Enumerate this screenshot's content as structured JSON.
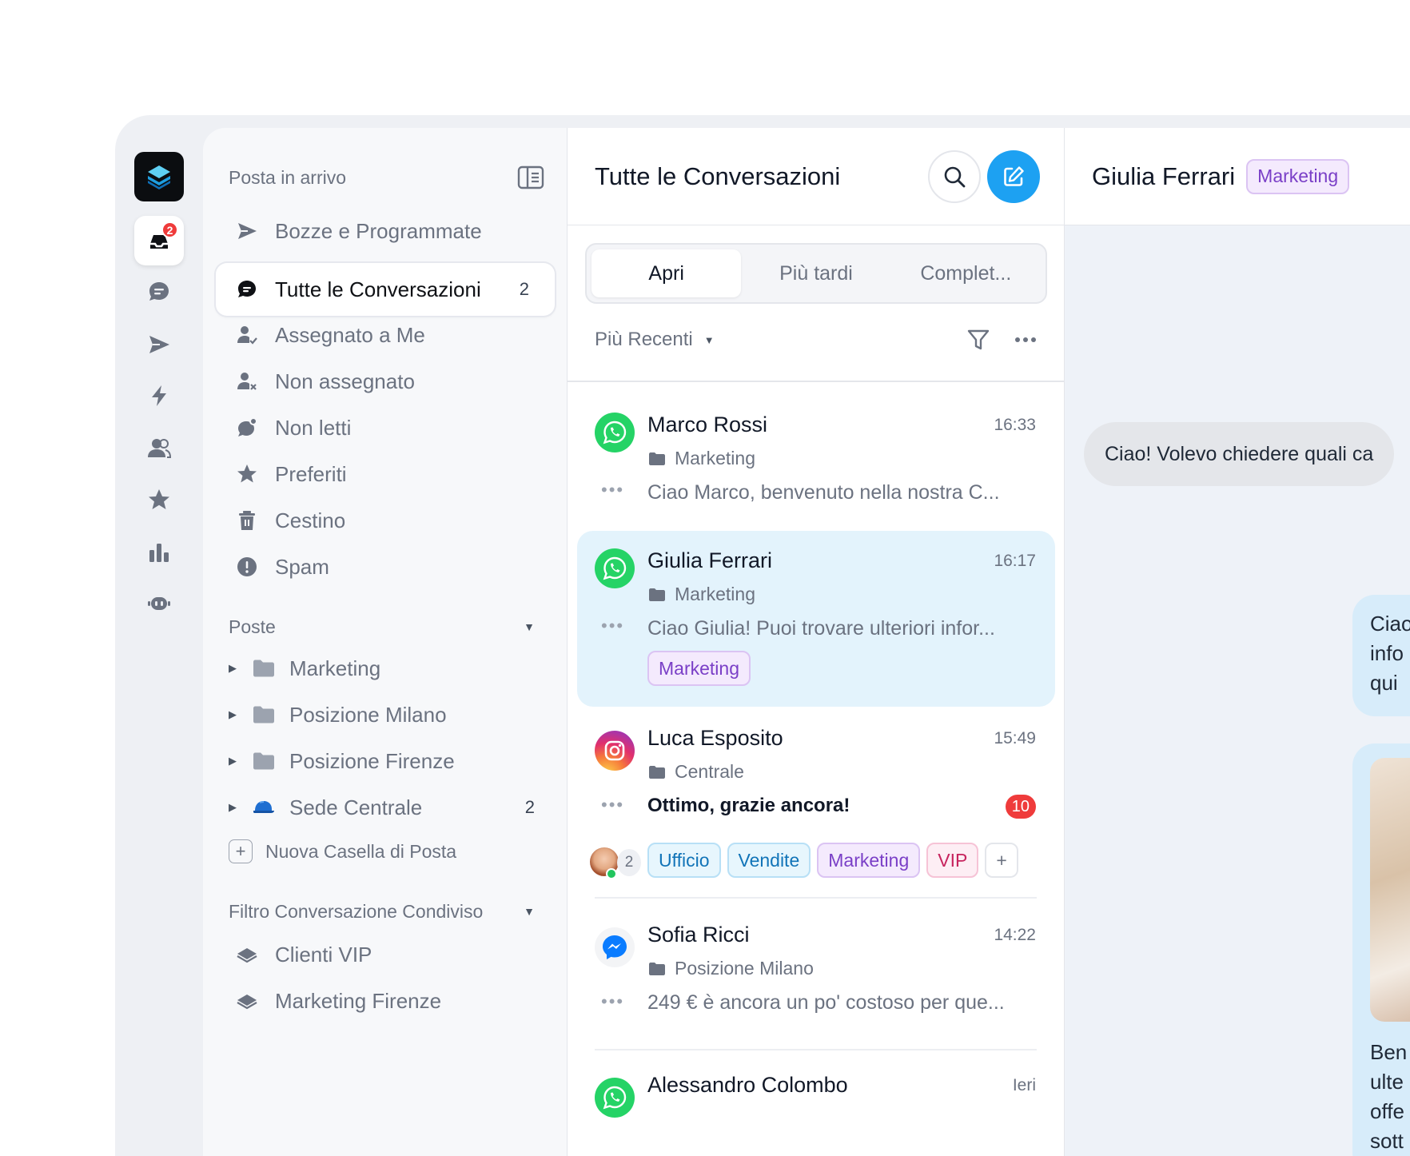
{
  "rail": {
    "inbox_badge": "2"
  },
  "nav": {
    "title": "Posta in arrivo",
    "items": [
      {
        "label": "Bozze e Programmate",
        "count": ""
      },
      {
        "label": "Tutte le Conversazioni",
        "count": "2"
      },
      {
        "label": "Assegnato a Me",
        "count": ""
      },
      {
        "label": "Non assegnato",
        "count": ""
      },
      {
        "label": "Non letti",
        "count": ""
      },
      {
        "label": "Preferiti",
        "count": ""
      },
      {
        "label": "Cestino",
        "count": ""
      },
      {
        "label": "Spam",
        "count": ""
      }
    ],
    "mail_section": "Poste",
    "mailboxes": [
      {
        "label": "Marketing",
        "count": ""
      },
      {
        "label": "Posizione Milano",
        "count": ""
      },
      {
        "label": "Posizione Firenze",
        "count": ""
      },
      {
        "label": "Sede Centrale",
        "count": "2"
      }
    ],
    "new_mailbox": "Nuova Casella di Posta",
    "shared_section": "Filtro Conversazione Condiviso",
    "shared_filters": [
      {
        "label": "Clienti VIP"
      },
      {
        "label": "Marketing Firenze"
      }
    ]
  },
  "list": {
    "title": "Tutte le Conversazioni",
    "tabs": [
      "Apri",
      "Più tardi",
      "Complet..."
    ],
    "sort_label": "Più Recenti",
    "conversations": [
      {
        "name": "Marco Rossi",
        "time": "16:33",
        "folder": "Marketing",
        "preview": "Ciao Marco, benvenuto nella nostra C...",
        "channel": "whatsapp"
      },
      {
        "name": "Giulia Ferrari",
        "time": "16:17",
        "folder": "Marketing",
        "preview": "Ciao Giulia! Puoi trovare ulteriori infor...",
        "channel": "whatsapp",
        "tags": [
          "Marketing"
        ]
      },
      {
        "name": "Luca Esposito",
        "time": "15:49",
        "folder": "Centrale",
        "preview": "Ottimo, grazie ancora!",
        "channel": "instagram",
        "unread": "10",
        "assignee_count": "2",
        "tags": [
          "Ufficio",
          "Vendite",
          "Marketing",
          "VIP",
          "+"
        ]
      },
      {
        "name": "Sofia Ricci",
        "time": "14:22",
        "folder": "Posizione Milano",
        "preview": "249 € è ancora un po' costoso per que...",
        "channel": "messenger"
      },
      {
        "name": "Alessandro Colombo",
        "time": "Ieri",
        "channel": "whatsapp"
      }
    ]
  },
  "chat": {
    "contact": "Giulia Ferrari",
    "tag": "Marketing",
    "incoming": "Ciao! Volevo chiedere quali ca",
    "outgoing_1": "Ciao\ninfo\nqui",
    "outgoing_2": "Ben\nulte\noffe\nsott"
  },
  "colors": {
    "accent": "#1da1f2",
    "selected_row": "#e3f3fc",
    "badge": "#ef3b3b",
    "whatsapp": "#25d366",
    "messenger": "#0a7cff"
  }
}
